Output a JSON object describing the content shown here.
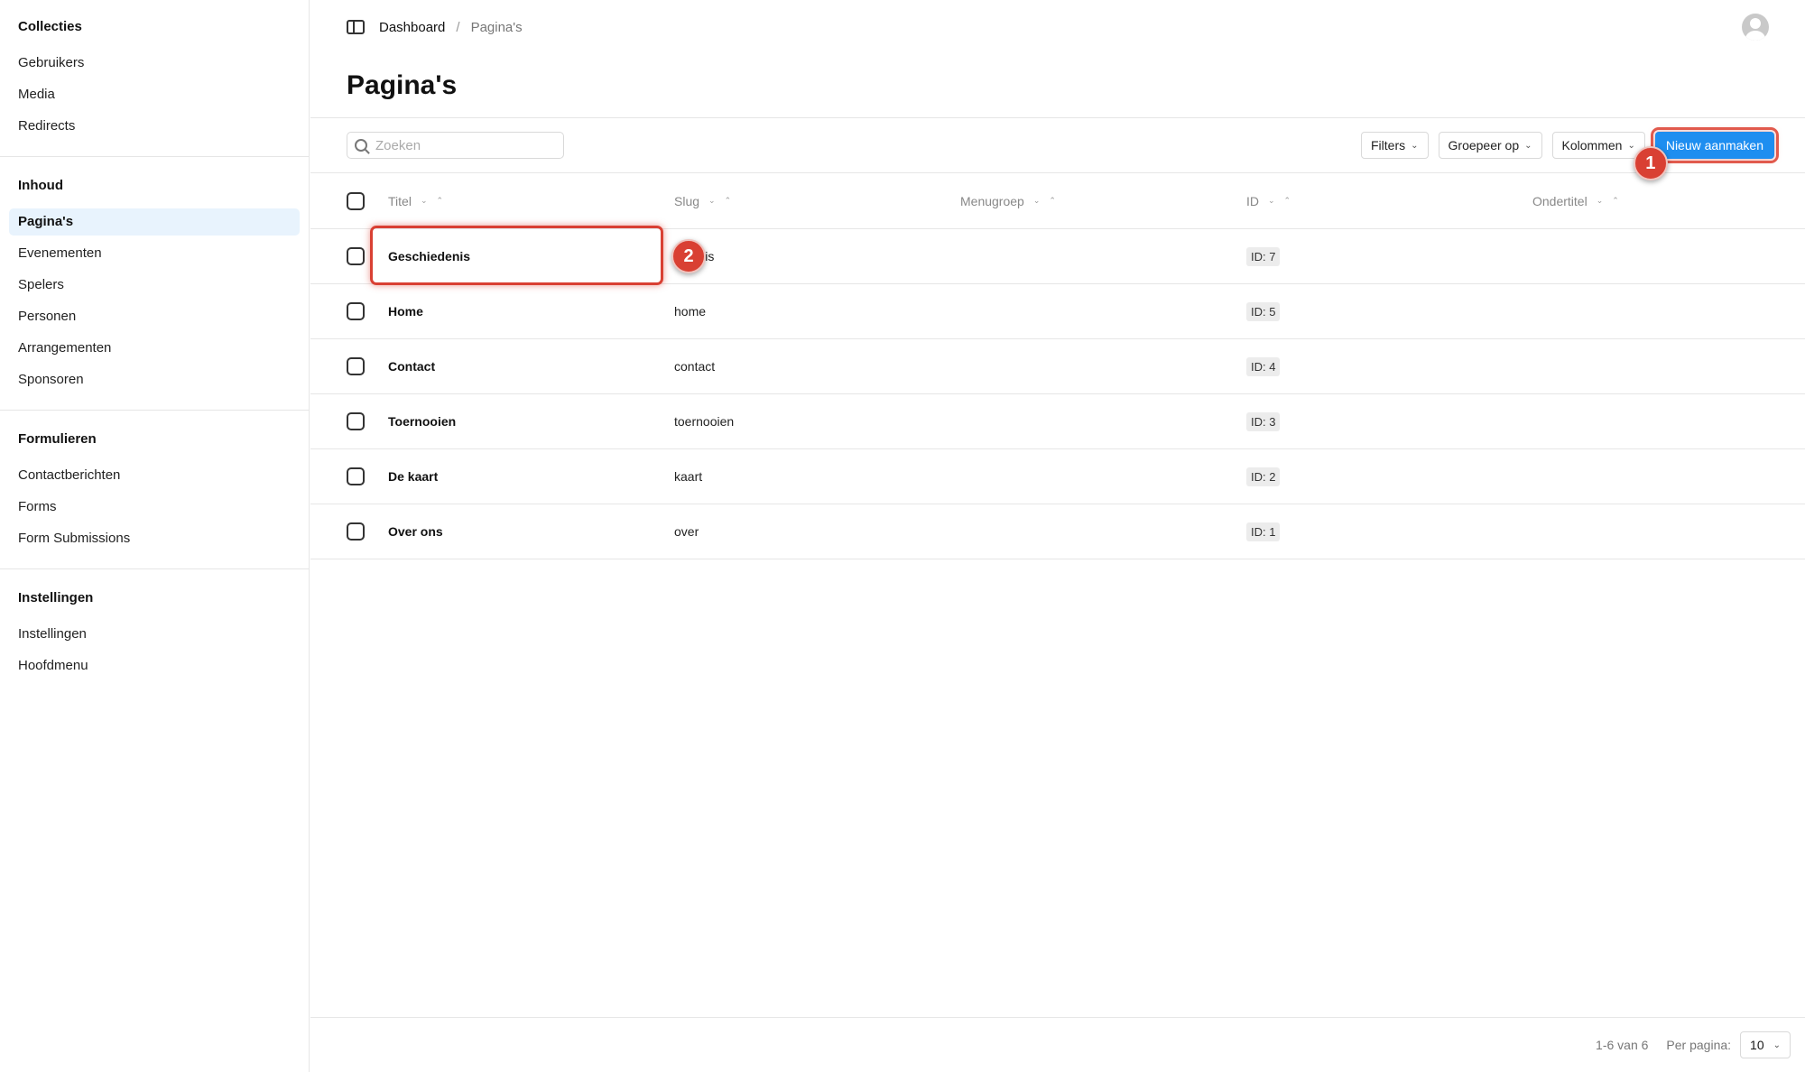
{
  "sidebar": {
    "groups": [
      {
        "heading": "Collecties",
        "items": [
          "Gebruikers",
          "Media",
          "Redirects"
        ]
      },
      {
        "heading": "Inhoud",
        "items": [
          "Pagina's",
          "Evenementen",
          "Spelers",
          "Personen",
          "Arrangementen",
          "Sponsoren"
        ]
      },
      {
        "heading": "Formulieren",
        "items": [
          "Contactberichten",
          "Forms",
          "Form Submissions"
        ]
      },
      {
        "heading": "Instellingen",
        "items": [
          "Instellingen",
          "Hoofdmenu"
        ]
      }
    ],
    "active_item": "Pagina's"
  },
  "breadcrumb": {
    "root": "Dashboard",
    "separator": "/",
    "current": "Pagina's"
  },
  "page": {
    "title": "Pagina's"
  },
  "toolbar": {
    "search_placeholder": "Zoeken",
    "filters_label": "Filters",
    "group_label": "Groepeer op",
    "columns_label": "Kolommen",
    "create_label": "Nieuw aanmaken",
    "marker_create": "1"
  },
  "table": {
    "columns": [
      "Titel",
      "Slug",
      "Menugroep",
      "ID",
      "Ondertitel"
    ],
    "rows": [
      {
        "title": "Geschiedenis",
        "slug": "iedenis",
        "menugroep": "",
        "id": "ID: 7",
        "ondertitel": ""
      },
      {
        "title": "Home",
        "slug": "home",
        "menugroep": "",
        "id": "ID: 5",
        "ondertitel": ""
      },
      {
        "title": "Contact",
        "slug": "contact",
        "menugroep": "",
        "id": "ID: 4",
        "ondertitel": ""
      },
      {
        "title": "Toernooien",
        "slug": "toernooien",
        "menugroep": "",
        "id": "ID: 3",
        "ondertitel": ""
      },
      {
        "title": "De kaart",
        "slug": "kaart",
        "menugroep": "",
        "id": "ID: 2",
        "ondertitel": ""
      },
      {
        "title": "Over ons",
        "slug": "over",
        "menugroep": "",
        "id": "ID: 1",
        "ondertitel": ""
      }
    ],
    "marker_row": "2"
  },
  "pagination": {
    "range": "1-6 van 6",
    "per_page_label": "Per pagina:",
    "per_page_value": "10"
  },
  "colors": {
    "accent": "#1e8ef0",
    "highlight": "#d94033",
    "active_nav_bg": "#e8f3fd"
  },
  "icons": {
    "panel_toggle": "sidebar-toggle-icon",
    "search": "search-icon",
    "avatar": "user-avatar-icon",
    "chevron": "chevron-down-icon",
    "sort": "sort-up-icon"
  }
}
